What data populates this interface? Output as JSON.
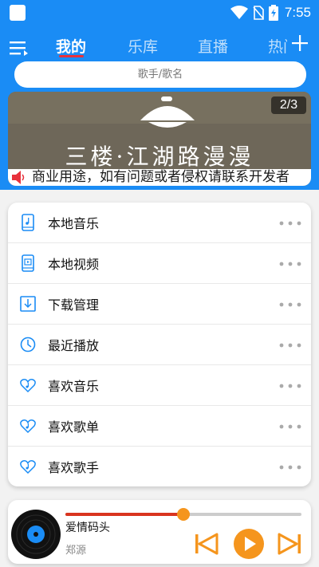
{
  "statusbar": {
    "time": "7:55"
  },
  "header": {
    "tabs": [
      {
        "label": "我的"
      },
      {
        "label": "乐库"
      },
      {
        "label": "直播"
      },
      {
        "label": "热门"
      }
    ]
  },
  "search": {
    "placeholder": "歌手/歌名"
  },
  "banner": {
    "counter": "2/3",
    "title": "三楼·江湖路漫漫",
    "marquee": "商业用途，如有问题或者侵权请联系开发者"
  },
  "menu": {
    "items": [
      {
        "label": "本地音乐",
        "icon": "phone-music-icon"
      },
      {
        "label": "本地视频",
        "icon": "phone-video-icon"
      },
      {
        "label": "下载管理",
        "icon": "download-icon"
      },
      {
        "label": "最近播放",
        "icon": "clock-icon"
      },
      {
        "label": "喜欢音乐",
        "icon": "heart-music-icon"
      },
      {
        "label": "喜欢歌单",
        "icon": "heart-music-icon"
      },
      {
        "label": "喜欢歌手",
        "icon": "heart-music-icon"
      }
    ]
  },
  "player": {
    "title": "爱情码头",
    "artist": "郑源",
    "progress": 0.5
  },
  "colors": {
    "primary": "#1a8cf5",
    "accent": "#f5951d",
    "progress": "#d9341e",
    "tab_underline": "#e8323c"
  }
}
